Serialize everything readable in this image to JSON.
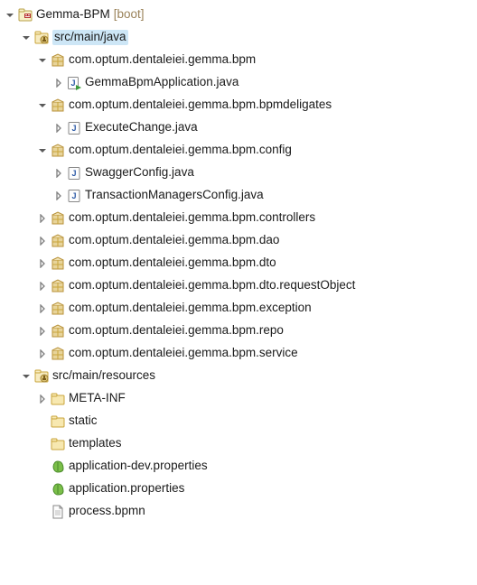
{
  "project": {
    "name": "Gemma-BPM",
    "suffix": "[boot]"
  },
  "tree": [
    {
      "depth": 0,
      "arrow": "down",
      "icon": "project",
      "label_path": "project.name",
      "suffix_path": "project.suffix"
    },
    {
      "depth": 1,
      "arrow": "down",
      "icon": "src-folder",
      "label_path": "src_java",
      "selected": true
    },
    {
      "depth": 2,
      "arrow": "down",
      "icon": "package",
      "label_path": "pkg.bpm"
    },
    {
      "depth": 3,
      "arrow": "right",
      "icon": "java-main",
      "label_path": "files.app"
    },
    {
      "depth": 2,
      "arrow": "down",
      "icon": "package",
      "label_path": "pkg.delegates"
    },
    {
      "depth": 3,
      "arrow": "right",
      "icon": "java",
      "label_path": "files.exec"
    },
    {
      "depth": 2,
      "arrow": "down",
      "icon": "package",
      "label_path": "pkg.config"
    },
    {
      "depth": 3,
      "arrow": "right",
      "icon": "java",
      "label_path": "files.swagger"
    },
    {
      "depth": 3,
      "arrow": "right",
      "icon": "java",
      "label_path": "files.txn"
    },
    {
      "depth": 2,
      "arrow": "right",
      "icon": "package",
      "label_path": "pkg.controllers"
    },
    {
      "depth": 2,
      "arrow": "right",
      "icon": "package",
      "label_path": "pkg.dao"
    },
    {
      "depth": 2,
      "arrow": "right",
      "icon": "package",
      "label_path": "pkg.dto"
    },
    {
      "depth": 2,
      "arrow": "right",
      "icon": "package",
      "label_path": "pkg.requestObject"
    },
    {
      "depth": 2,
      "arrow": "right",
      "icon": "package",
      "label_path": "pkg.exception"
    },
    {
      "depth": 2,
      "arrow": "right",
      "icon": "package",
      "label_path": "pkg.repo"
    },
    {
      "depth": 2,
      "arrow": "right",
      "icon": "package",
      "label_path": "pkg.service"
    },
    {
      "depth": 1,
      "arrow": "down",
      "icon": "src-folder",
      "label_path": "src_res"
    },
    {
      "depth": 2,
      "arrow": "right",
      "icon": "folder",
      "label_path": "res.meta"
    },
    {
      "depth": 2,
      "arrow": "none",
      "icon": "folder",
      "label_path": "res.static"
    },
    {
      "depth": 2,
      "arrow": "none",
      "icon": "folder",
      "label_path": "res.templates"
    },
    {
      "depth": 2,
      "arrow": "none",
      "icon": "leaf",
      "label_path": "res.appdev"
    },
    {
      "depth": 2,
      "arrow": "none",
      "icon": "leaf",
      "label_path": "res.app"
    },
    {
      "depth": 2,
      "arrow": "none",
      "icon": "file",
      "label_path": "res.process"
    }
  ],
  "src_java": "src/main/java",
  "src_res": "src/main/resources",
  "pkg": {
    "bpm": "com.optum.dentaleiei.gemma.bpm",
    "delegates": "com.optum.dentaleiei.gemma.bpm.bpmdeligates",
    "config": "com.optum.dentaleiei.gemma.bpm.config",
    "controllers": "com.optum.dentaleiei.gemma.bpm.controllers",
    "dao": "com.optum.dentaleiei.gemma.bpm.dao",
    "dto": "com.optum.dentaleiei.gemma.bpm.dto",
    "requestObject": "com.optum.dentaleiei.gemma.bpm.dto.requestObject",
    "exception": "com.optum.dentaleiei.gemma.bpm.exception",
    "repo": "com.optum.dentaleiei.gemma.bpm.repo",
    "service": "com.optum.dentaleiei.gemma.bpm.service"
  },
  "files": {
    "app": "GemmaBpmApplication.java",
    "exec": "ExecuteChange.java",
    "swagger": "SwaggerConfig.java",
    "txn": "TransactionManagersConfig.java"
  },
  "res": {
    "meta": "META-INF",
    "static": "static",
    "templates": "templates",
    "appdev": "application-dev.properties",
    "app": "application.properties",
    "process": "process.bpmn"
  }
}
